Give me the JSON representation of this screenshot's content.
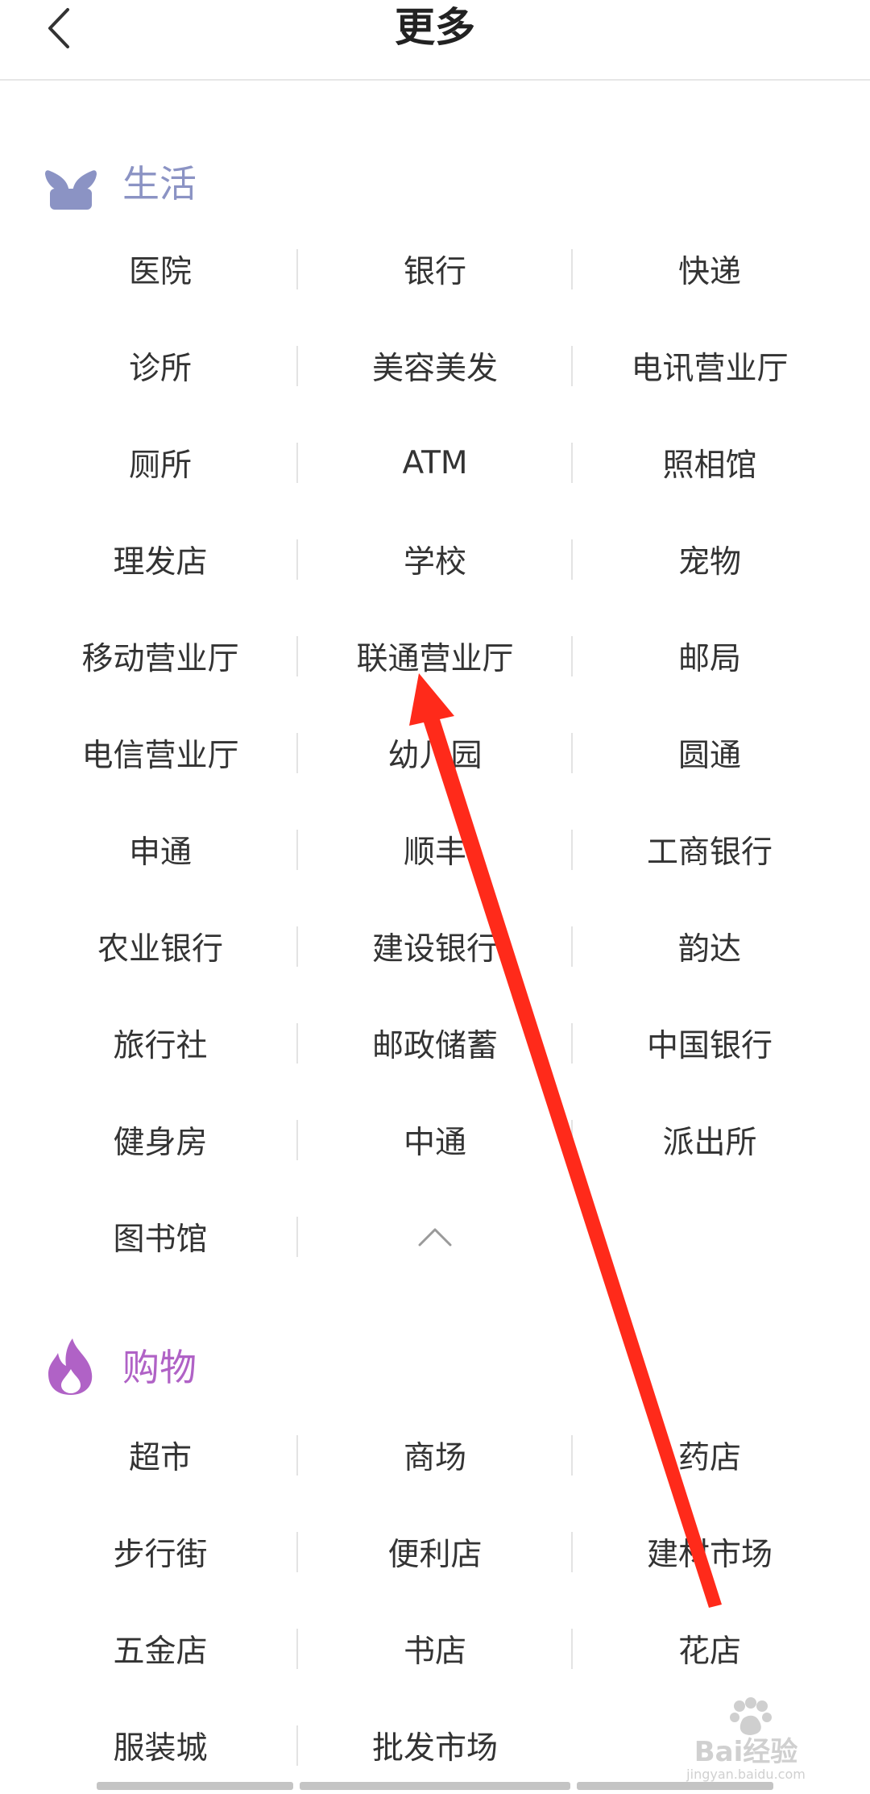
{
  "header": {
    "title": "更多"
  },
  "colors": {
    "life_accent": "#8b93c4",
    "shopping_accent": "#b062c6",
    "annotation_arrow": "#ff2a1a"
  },
  "sections": {
    "life": {
      "label": "生活",
      "icon": "sprout-icon",
      "items": [
        "医院",
        "银行",
        "快递",
        "诊所",
        "美容美发",
        "电讯营业厅",
        "厕所",
        "ATM",
        "照相馆",
        "理发店",
        "学校",
        "宠物",
        "移动营业厅",
        "联通营业厅",
        "邮局",
        "电信营业厅",
        "幼儿园",
        "圆通",
        "申通",
        "顺丰",
        "工商银行",
        "农业银行",
        "建设银行",
        "韵达",
        "旅行社",
        "邮政储蓄",
        "中国银行",
        "健身房",
        "中通",
        "派出所",
        "图书馆"
      ],
      "collapse_icon": "chevron-up-icon"
    },
    "shopping": {
      "label": "购物",
      "icon": "flame-icon",
      "items": [
        "超市",
        "商场",
        "药店",
        "步行街",
        "便利店",
        "建材市场",
        "五金店",
        "书店",
        "花店",
        "服装城",
        "批发市场"
      ]
    }
  },
  "watermark": {
    "text": "Bai经验",
    "subtext": "jingyan.baidu.com"
  }
}
